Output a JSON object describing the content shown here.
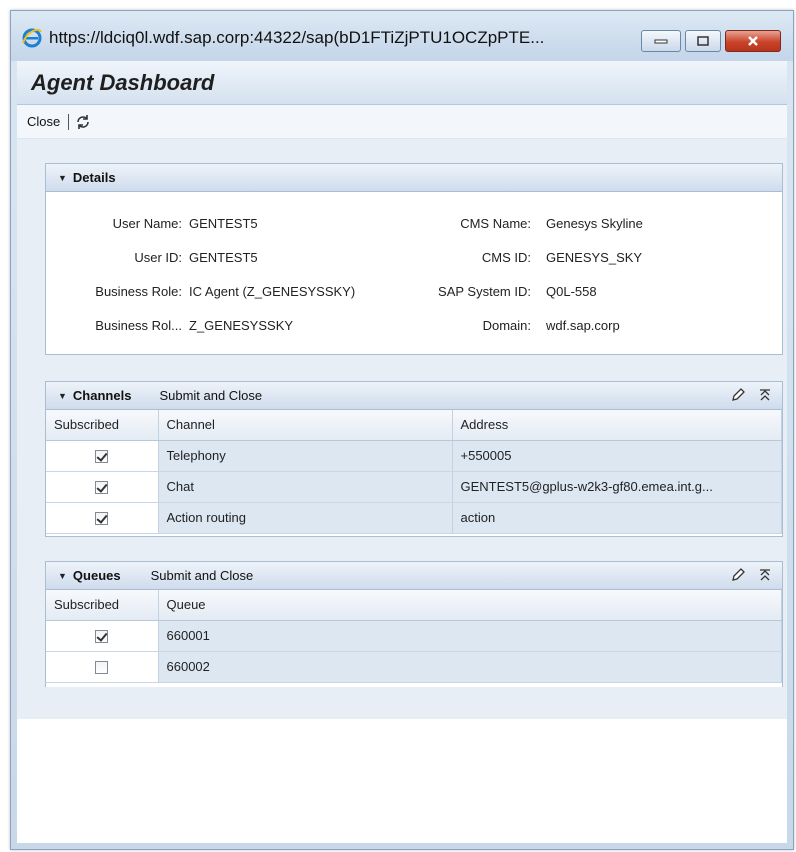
{
  "window": {
    "title_url": "https://ldciq0l.wdf.sap.corp:44322/sap(bD1FTiZjPTU1OCZpPTE..."
  },
  "app": {
    "title": "Agent Dashboard"
  },
  "toolbar": {
    "close_label": "Close"
  },
  "details": {
    "header": "Details",
    "fields_left": [
      {
        "label": "User Name:",
        "value": "GENTEST5"
      },
      {
        "label": "User ID:",
        "value": "GENTEST5"
      },
      {
        "label": "Business Role:",
        "value": "IC Agent (Z_GENESYSSKY)"
      },
      {
        "label": "Business Rol...",
        "value": "Z_GENESYSSKY"
      }
    ],
    "fields_right": [
      {
        "label": "CMS Name:",
        "value": "Genesys Skyline"
      },
      {
        "label": "CMS ID:",
        "value": "GENESYS_SKY"
      },
      {
        "label": "SAP System ID:",
        "value": "Q0L-558"
      },
      {
        "label": "Domain:",
        "value": "wdf.sap.corp"
      }
    ]
  },
  "channels": {
    "header": "Channels",
    "action": "Submit and Close",
    "columns": [
      "Subscribed",
      "Channel",
      "Address"
    ],
    "rows": [
      {
        "subscribed": true,
        "channel": "Telephony",
        "address": "+550005"
      },
      {
        "subscribed": true,
        "channel": "Chat",
        "address": "GENTEST5@gplus-w2k3-gf80.emea.int.g..."
      },
      {
        "subscribed": true,
        "channel": "Action routing",
        "address": "action"
      }
    ]
  },
  "queues": {
    "header": "Queues",
    "action": "Submit and Close",
    "columns": [
      "Subscribed",
      "Queue"
    ],
    "rows": [
      {
        "subscribed": true,
        "queue": "660001"
      },
      {
        "subscribed": false,
        "queue": "660002"
      }
    ]
  },
  "colors": {
    "accent": "#c3d5e9",
    "grid_cell": "#dde7f2"
  }
}
